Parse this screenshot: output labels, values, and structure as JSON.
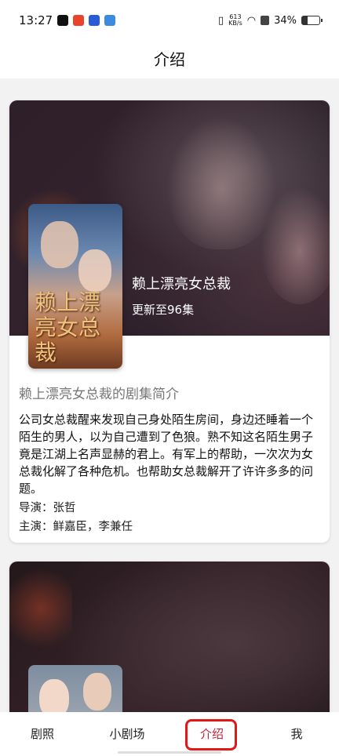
{
  "status_bar": {
    "time": "13:27",
    "net_speed_value": "613",
    "net_speed_unit": "KB/s",
    "battery": "34%",
    "battery_level": 0.34,
    "app_icons": [
      "tiktok-icon",
      "weibo-icon",
      "app-icon",
      "app-icon-2"
    ]
  },
  "header": {
    "title": "介绍"
  },
  "cards": [
    {
      "hero_title": "赖上漂亮女总裁",
      "hero_subtitle": "更新至96集",
      "poster_art": "赖上漂亮女总裁",
      "synopsis_title": "赖上漂亮女总裁的剧集简介",
      "synopsis": "公司女总裁醒来发现自己身处陌生房间，身边还睡着一个陌生的男人，以为自己遭到了色狼。熟不知这名陌生男子竟是江湖上名声显赫的君上。有军上的帮助，一次次为女总裁化解了各种危机。也帮助女总裁解开了许许多多的问题。",
      "director": "导演：张哲",
      "cast": "主演：鲜嘉臣，李兼任"
    }
  ],
  "bottom_nav": {
    "items": [
      {
        "label": "剧照"
      },
      {
        "label": "小剧场"
      },
      {
        "label": "介绍"
      },
      {
        "label": "我"
      }
    ],
    "active_index": 2
  },
  "colors": {
    "active_tab": "#c0203a",
    "highlight_border": "#e01818"
  }
}
